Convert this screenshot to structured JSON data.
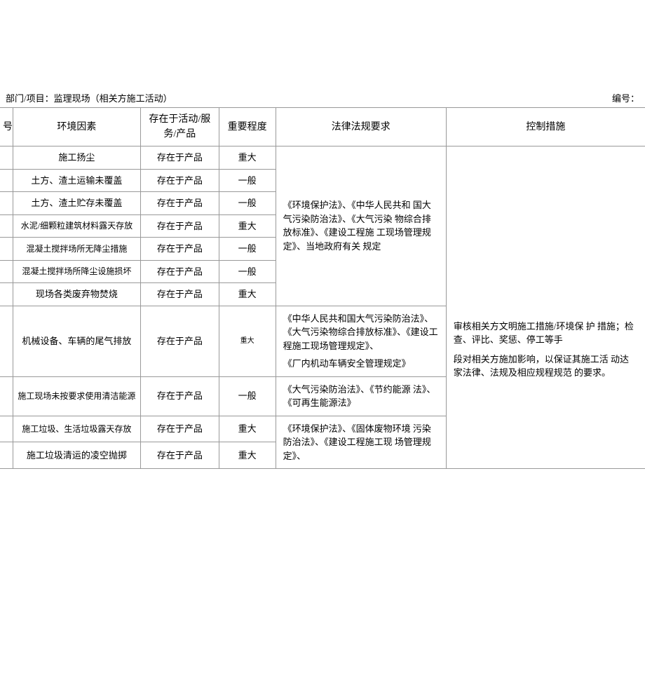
{
  "header": {
    "dept_label": "部门/项目：监理现场（相关方施工活动）",
    "code_label": "编号："
  },
  "columns": {
    "seq": "号",
    "factor": "环境因素",
    "exist": "存在于活动/服务/产品",
    "level": "重要程度",
    "law": "法律法规要求",
    "measure": "控制措施"
  },
  "rows": [
    {
      "factor": "施工扬尘",
      "exist": "存在于产品",
      "level": "重大"
    },
    {
      "factor": "土方、渣土运输未覆盖",
      "exist": "存在于产品",
      "level": "一般"
    },
    {
      "factor": "土方、渣土贮存未覆盖",
      "exist": "存在于产品",
      "level": "一般"
    },
    {
      "factor": "水泥/细颗粒建筑材料露天存放",
      "exist": "存在于产品",
      "level": "重大"
    },
    {
      "factor": "混凝土搅拌场所无降尘措施",
      "exist": "存在于产品",
      "level": "一般"
    },
    {
      "factor": "混凝土搅拌场所降尘设施损坏",
      "exist": "存在于产品",
      "level": "一般"
    },
    {
      "factor": "现场各类废弃物焚烧",
      "exist": "存在于产品",
      "level": "重大"
    },
    {
      "factor": "机械设备、车辆的尾气排放",
      "exist": "存在于产品",
      "level": "重大"
    },
    {
      "factor": "施工现场未按要求使用清洁能源",
      "exist": "存在于产品",
      "level": "一般"
    },
    {
      "factor": "施工垃圾、生活垃圾露天存放",
      "exist": "存在于产品",
      "level": "重大"
    },
    {
      "factor": "施工垃圾清运的凌空抛掷",
      "exist": "存在于产品",
      "level": "重大"
    }
  ],
  "law_group1": "《环境保护法》、《中华人民共和 国大气污染防治法》、《大气污染 物综合排放标准》、《建设工程施 工现场管理规定》、当地政府有关 规定",
  "law_group2a": "《中华人民共和国大气污染防治法》、《大气污染物综合排放标准》、《建设工程施工现场管理规定》、",
  "law_group2b": "《厂内机动车辆安全管理规定》",
  "law_group3": "《大气污染防治法》、《节约能源 法》、《可再生能源法》",
  "law_group4": "《环境保护法》、《固体废物环境 污染防治法》、《建设工程施工现 场管理规定》、",
  "measure_text1": "审核相关方文明施工措施/环境保  护  措施；检查、评比、奖惩、停工等手",
  "measure_text2": "段对相关方施加影响，以保证其施工活  动达家法律、法规及相应规程规范  的要求。"
}
